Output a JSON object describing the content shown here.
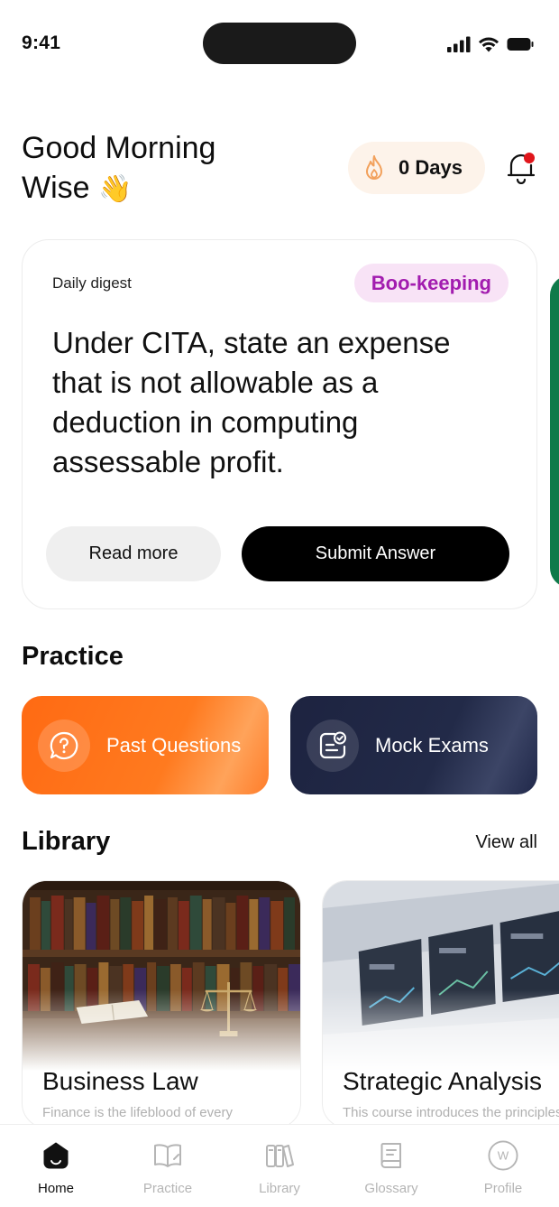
{
  "status_bar": {
    "time": "9:41"
  },
  "header": {
    "greeting_line1": "Good Morning",
    "greeting_line2": "Wise",
    "wave_emoji": "👋",
    "streak": {
      "icon": "flame-icon",
      "label": "0 Days"
    },
    "notification_badge_color": "#e0151b"
  },
  "digest": {
    "label": "Daily digest",
    "tag": "Boo-keeping",
    "question": "Under CITA, state an expense that is not allowable as a deduction in computing assessable profit.",
    "read_more": "Read more",
    "submit": "Submit Answer"
  },
  "practice": {
    "title": "Practice",
    "items": [
      {
        "label": "Past Questions",
        "icon": "question-bubble-icon",
        "color": "#ff6a13"
      },
      {
        "label": "Mock Exams",
        "icon": "exam-checklist-icon",
        "color": "#1f2542"
      }
    ]
  },
  "library": {
    "title": "Library",
    "view_all": "View all",
    "items": [
      {
        "title": "Business Law",
        "description": "Finance is the lifeblood of every"
      },
      {
        "title": "Strategic Analysis",
        "description": "This course introduces the principles"
      }
    ]
  },
  "tabs": [
    {
      "label": "Home",
      "icon": "home-icon",
      "active": true
    },
    {
      "label": "Practice",
      "icon": "open-book-icon",
      "active": false
    },
    {
      "label": "Library",
      "icon": "books-icon",
      "active": false
    },
    {
      "label": "Glossary",
      "icon": "glossary-book-icon",
      "active": false
    },
    {
      "label": "Profile",
      "icon": "profile-avatar-icon",
      "avatar_letter": "W",
      "active": false
    }
  ],
  "colors": {
    "accent_orange": "#ff6a13",
    "navy": "#1f2542",
    "tag_purple": "#a21caf",
    "green_edge": "#0f7a4a"
  }
}
